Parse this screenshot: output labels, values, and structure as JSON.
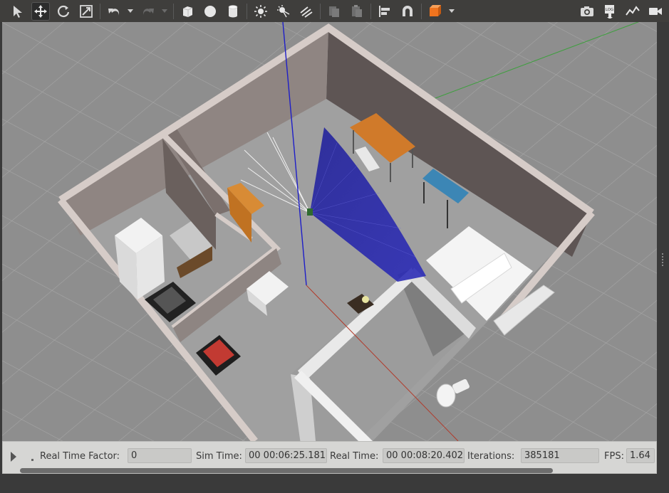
{
  "toolbar": {
    "tools": [
      {
        "name": "select-mode-icon"
      },
      {
        "name": "translate-mode-icon"
      },
      {
        "name": "rotate-mode-icon"
      },
      {
        "name": "scale-mode-icon"
      },
      {
        "name": "undo-icon"
      },
      {
        "name": "redo-icon"
      },
      {
        "name": "box-shape-icon"
      },
      {
        "name": "sphere-shape-icon"
      },
      {
        "name": "cylinder-shape-icon"
      },
      {
        "name": "point-light-icon"
      },
      {
        "name": "spot-light-icon"
      },
      {
        "name": "directional-light-icon"
      },
      {
        "name": "copy-icon"
      },
      {
        "name": "paste-icon"
      },
      {
        "name": "align-icon"
      },
      {
        "name": "snap-icon"
      },
      {
        "name": "view-angle-icon"
      },
      {
        "name": "screenshot-icon"
      },
      {
        "name": "log-icon"
      },
      {
        "name": "plot-icon"
      },
      {
        "name": "video-record-icon"
      }
    ],
    "log_text": "LOG",
    "accent_color": "#f0741e"
  },
  "status": {
    "real_time_factor_label": "Real Time Factor:",
    "real_time_factor_value": "0",
    "sim_time_label": "Sim Time:",
    "sim_time_value": "00 00:06:25.181",
    "real_time_label": "Real Time:",
    "real_time_value": "00 00:08:20.402",
    "iterations_label": "Iterations:",
    "iterations_value": "385181",
    "fps_label": "FPS:",
    "fps_value": "1.64"
  },
  "scene": {
    "description_colors": {
      "ground": "#8c8c8c",
      "wall_top": "#d2c8c4",
      "wall_inner": "#9b8f8b",
      "laser_scan": "#1a1aa8"
    }
  }
}
